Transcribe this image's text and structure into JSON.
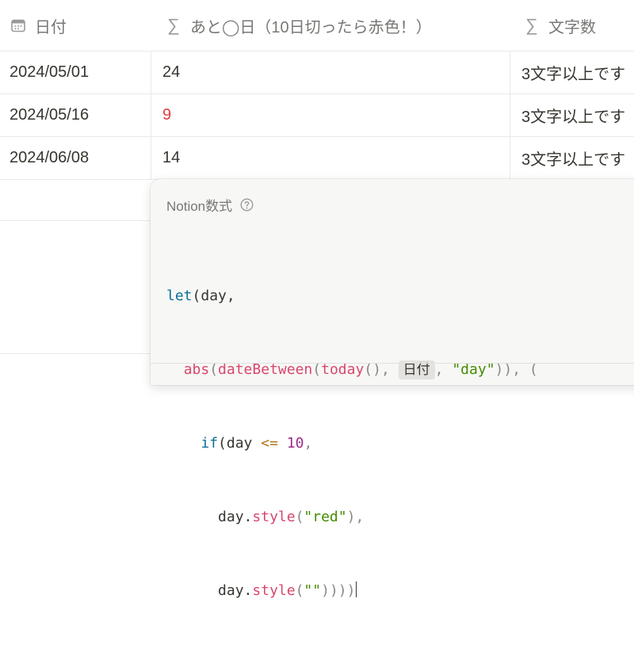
{
  "table": {
    "columns": [
      {
        "icon": "calendar-icon",
        "label": "日付"
      },
      {
        "icon": "sigma-icon",
        "glyph": "∑",
        "label": "あと◯日（10日切ったら赤色！）"
      },
      {
        "icon": "sigma-icon",
        "glyph": "∑",
        "label": "文字数"
      }
    ],
    "rows": [
      {
        "date": "2024/05/01",
        "days": "24",
        "chars": "3文字以上です"
      },
      {
        "date": "2024/05/16",
        "days": "9",
        "chars": "3文字以上です"
      },
      {
        "date": "2024/06/08",
        "days": "14",
        "chars": "3文字以上です"
      }
    ]
  },
  "formula_popup": {
    "title": "Notion数式",
    "help_icon": "question-circle-icon",
    "code": {
      "l1_kw": "let",
      "l1_rest": "(day,",
      "l2_fn1": "abs",
      "l2_p1": "(",
      "l2_fn2": "dateBetween",
      "l2_p2": "(",
      "l2_fn3": "today",
      "l2_p3": "(), ",
      "l2_chip": "日付",
      "l2_p4": ", ",
      "l2_str": "\"day\"",
      "l2_p5": ")), (",
      "l3_kw": "if",
      "l3_p1": "(day ",
      "l3_op": "<=",
      "l3_p2": " ",
      "l3_num": "10",
      "l3_p3": ",",
      "l4_p1": "day.",
      "l4_fn": "style",
      "l4_p2": "(",
      "l4_str": "\"red\"",
      "l4_p3": "),",
      "l5_p1": "day.",
      "l5_fn": "style",
      "l5_p2": "(",
      "l5_str": "\"\"",
      "l5_p3": "))))"
    }
  },
  "colors": {
    "red_text": "#e03e3e",
    "keyword": "#0b6e99",
    "function": "#d9476c",
    "string": "#448b00",
    "number": "#9b2c8b"
  }
}
